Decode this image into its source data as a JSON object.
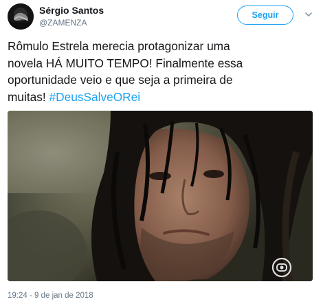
{
  "author": {
    "name": "Sérgio Santos",
    "handle": "@ZAMENZA"
  },
  "follow_button": {
    "label": "Seguir"
  },
  "tweet": {
    "lines": [
      "Rômulo Estrela merecia protagonizar uma",
      "novela HÁ MUITO TEMPO! Finalmente essa",
      "oportunidade veio e que seja a primeira de"
    ],
    "last_line_prefix": "muitas! ",
    "hashtag": "#DeusSalveORei"
  },
  "media": {
    "description_icon": "globo-logo-icon"
  },
  "timestamp": "19:24 - 9 de jan de 2018",
  "colors": {
    "accent": "#1da1f2",
    "text": "#14171a",
    "muted": "#657786"
  }
}
